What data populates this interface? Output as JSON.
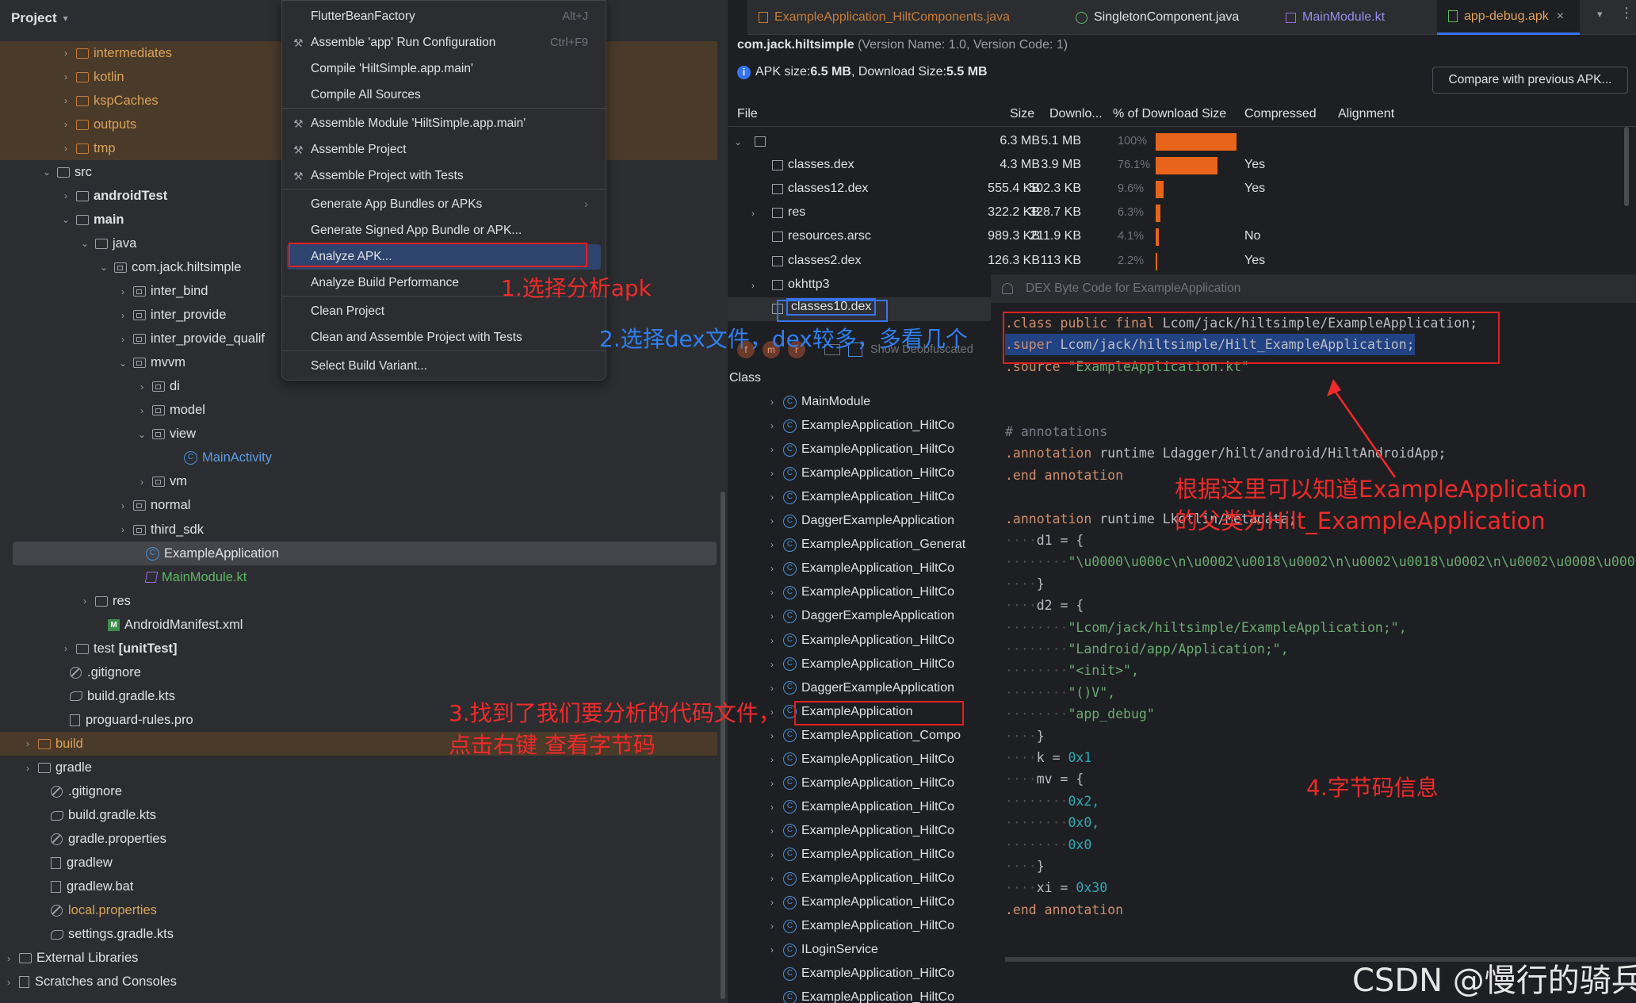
{
  "project": {
    "title": "Project",
    "header_chevron": "chevron-down",
    "rows": [
      {
        "label": "intermediates",
        "kind": "folder",
        "bold": false
      },
      {
        "label": "kotlin",
        "kind": "folder",
        "bold": false
      },
      {
        "label": "kspCaches",
        "kind": "folder",
        "bold": false
      },
      {
        "label": "outputs",
        "kind": "folder",
        "bold": false
      },
      {
        "label": "tmp",
        "kind": "folder",
        "bold": false
      },
      {
        "label": "src",
        "kind": "folder",
        "bold": false
      },
      {
        "label": "androidTest",
        "kind": "folder",
        "bold": true
      },
      {
        "label": "main",
        "kind": "folder",
        "bold": true
      },
      {
        "label": "java",
        "kind": "folder",
        "bold": false
      },
      {
        "label": "com.jack.hiltsimple",
        "kind": "package",
        "bold": false
      },
      {
        "label": "inter_bind",
        "kind": "package",
        "bold": false
      },
      {
        "label": "inter_provide",
        "kind": "package",
        "bold": false
      },
      {
        "label": "inter_provide_qualif",
        "kind": "package",
        "bold": false
      },
      {
        "label": "mvvm",
        "kind": "package",
        "bold": false
      },
      {
        "label": "di",
        "kind": "package",
        "bold": false
      },
      {
        "label": "model",
        "kind": "package",
        "bold": false
      },
      {
        "label": "view",
        "kind": "package",
        "bold": false
      },
      {
        "label": "MainActivity",
        "kind": "class",
        "bold": false
      },
      {
        "label": "vm",
        "kind": "package",
        "bold": false
      },
      {
        "label": "normal",
        "kind": "package",
        "bold": false
      },
      {
        "label": "third_sdk",
        "kind": "package",
        "bold": false
      },
      {
        "label": "ExampleApplication",
        "kind": "class",
        "bold": false
      },
      {
        "label": "MainModule.kt",
        "kind": "kotlin",
        "bold": false
      },
      {
        "label": "res",
        "kind": "folder",
        "bold": false
      },
      {
        "label": "AndroidManifest.xml",
        "kind": "manifest",
        "bold": false
      },
      {
        "label": "test",
        "suffix": "[unitTest]",
        "kind": "folder",
        "bold": false
      },
      {
        "label": ".gitignore",
        "kind": "gitignore",
        "bold": false
      },
      {
        "label": "build.gradle.kts",
        "kind": "gradle",
        "bold": false
      },
      {
        "label": "proguard-rules.pro",
        "kind": "text",
        "bold": false
      },
      {
        "label": "build",
        "kind": "folder",
        "bold": false
      },
      {
        "label": "gradle",
        "kind": "folder",
        "bold": false
      },
      {
        "label": ".gitignore",
        "kind": "gitignore",
        "bold": false
      },
      {
        "label": "build.gradle.kts",
        "kind": "gradle",
        "bold": false
      },
      {
        "label": "gradle.properties",
        "kind": "gear",
        "bold": false
      },
      {
        "label": "gradlew",
        "kind": "terminal",
        "bold": false
      },
      {
        "label": "gradlew.bat",
        "kind": "text",
        "bold": false
      },
      {
        "label": "local.properties",
        "kind": "gear",
        "bold": false
      },
      {
        "label": "settings.gradle.kts",
        "kind": "gradle",
        "bold": false
      },
      {
        "label": "External Libraries",
        "kind": "library",
        "bold": false
      },
      {
        "label": "Scratches and Consoles",
        "kind": "scratch",
        "bold": false
      }
    ]
  },
  "menu": {
    "items": [
      {
        "label": "FlutterBeanFactory",
        "shortcut": "Alt+J"
      },
      {
        "label": "Assemble 'app' Run Configuration",
        "shortcut": "Ctrl+F9"
      },
      {
        "label": "Compile 'HiltSimple.app.main'",
        "shortcut": ""
      },
      {
        "label": "Compile All Sources",
        "shortcut": ""
      },
      {
        "label": "Assemble Module 'HiltSimple.app.main'",
        "shortcut": ""
      },
      {
        "label": "Assemble Project",
        "shortcut": ""
      },
      {
        "label": "Assemble Project with Tests",
        "shortcut": ""
      },
      {
        "label": "Generate App Bundles or APKs",
        "shortcut": "›"
      },
      {
        "label": "Generate Signed App Bundle or APK...",
        "shortcut": ""
      },
      {
        "label": "Analyze APK...",
        "shortcut": ""
      },
      {
        "label": "Analyze Build Performance",
        "shortcut": ""
      },
      {
        "label": "Clean Project",
        "shortcut": ""
      },
      {
        "label": "Clean and Assemble Project with Tests",
        "shortcut": ""
      },
      {
        "label": "Select Build Variant...",
        "shortcut": ""
      }
    ]
  },
  "tabs": [
    {
      "label": "ExampleApplication_HiltComponents.java"
    },
    {
      "label": "SingletonComponent.java"
    },
    {
      "label": "MainModule.kt"
    },
    {
      "label": "app-debug.apk",
      "close": "×"
    }
  ],
  "apk": {
    "package": "com.jack.hiltsimple",
    "version": "(Version Name: 1.0, Version Code: 1)",
    "size_prefix": "APK size: ",
    "apk_size": "6.5 MB",
    "download_prefix": ", Download Size: ",
    "download_size": "5.5 MB",
    "compare_button": "Compare with previous APK...",
    "columns": [
      "File",
      "Size",
      "Downlo...",
      "% of Download Size",
      "Compressed",
      "Alignment"
    ],
    "files": [
      {
        "name": "",
        "size": "6.3 MB",
        "download": "5.1 MB",
        "pct": "100%",
        "pct_value": 100,
        "compressed": ""
      },
      {
        "name": "classes.dex",
        "size": "4.3 MB",
        "download": "3.9 MB",
        "pct": "76.1%",
        "pct_value": 76.1,
        "compressed": "Yes"
      },
      {
        "name": "classes12.dex",
        "size": "555.4 KB",
        "download": "502.3 KB",
        "pct": "9.6%",
        "pct_value": 9.6,
        "compressed": "Yes"
      },
      {
        "name": "res",
        "size": "322.2 KB",
        "download": "328.7 KB",
        "pct": "6.3%",
        "pct_value": 6.3,
        "compressed": ""
      },
      {
        "name": "resources.arsc",
        "size": "989.3 KB",
        "download": "211.9 KB",
        "pct": "4.1%",
        "pct_value": 4.1,
        "compressed": "No"
      },
      {
        "name": "classes2.dex",
        "size": "126.3 KB",
        "download": "113 KB",
        "pct": "2.2%",
        "pct_value": 2.2,
        "compressed": "Yes"
      },
      {
        "name": "okhttp3",
        "size": "",
        "download": "",
        "pct": "",
        "pct_value": 0,
        "compressed": ""
      },
      {
        "name": "classes10.dex",
        "size": "",
        "download": "",
        "pct": "",
        "pct_value": 0,
        "compressed": ""
      }
    ],
    "dex_panel_title": "DEX Byte Code for ExampleApplication",
    "show_deobf": "Show Deobfuscated",
    "class_header": "Class",
    "classes": [
      "MainModule",
      "ExampleApplication_HiltCo",
      "ExampleApplication_HiltCo",
      "ExampleApplication_HiltCo",
      "ExampleApplication_HiltCo",
      "DaggerExampleApplication",
      "ExampleApplication_Generat",
      "ExampleApplication_HiltCo",
      "ExampleApplication_HiltCo",
      "DaggerExampleApplication",
      "ExampleApplication_HiltCo",
      "ExampleApplication_HiltCo",
      "DaggerExampleApplication",
      "ExampleApplication",
      "ExampleApplication_Compo",
      "ExampleApplication_HiltCo",
      "ExampleApplication_HiltCo",
      "ExampleApplication_HiltCo",
      "ExampleApplication_HiltCo",
      "ExampleApplication_HiltCo",
      "ExampleApplication_HiltCo",
      "ExampleApplication_HiltCo",
      "ExampleApplication_HiltCo",
      "ILoginService",
      "ExampleApplication_HiltCo",
      "ExampleApplication_HiltCo"
    ]
  },
  "bytecode": [
    [
      [
        ".class public final ",
        "k"
      ],
      [
        "Lcom/jack/hiltsimple/ExampleApplication;",
        "w"
      ]
    ],
    [
      [
        ".super ",
        "k"
      ],
      [
        "Lcom/jack/hiltsimple/Hilt_ExampleApplication",
        "w"
      ],
      [
        ";",
        "w"
      ]
    ],
    [
      [
        ".source ",
        "k"
      ],
      [
        "\"ExampleApplication.kt\"",
        "s"
      ]
    ],
    [],
    [],
    [
      [
        "# annotations",
        "c"
      ]
    ],
    [
      [
        ".annotation ",
        "k"
      ],
      [
        "runtime Ldagger/hilt/android/HiltAndroidApp;",
        "w"
      ]
    ],
    [
      [
        ".end annotation",
        "k"
      ]
    ],
    [],
    [
      [
        ".annotation ",
        "k"
      ],
      [
        "runtime Lkotlin/Metadata;",
        "w"
      ]
    ],
    [
      [
        "····",
        "d"
      ],
      [
        "d1 = {",
        "w"
      ]
    ],
    [
      [
        "········",
        "d"
      ],
      [
        "\"\\u0000\\u000c\\n\\u0002\\u0018\\u0002\\n\\u0002\\u0018\\u0002\\n\\u0002\\u0008\\u000",
        "s"
      ]
    ],
    [
      [
        "····",
        "d"
      ],
      [
        "}",
        "w"
      ]
    ],
    [
      [
        "····",
        "d"
      ],
      [
        "d2 = {",
        "w"
      ]
    ],
    [
      [
        "········",
        "d"
      ],
      [
        "\"Lcom/jack/hiltsimple/ExampleApplication;\",",
        "s"
      ]
    ],
    [
      [
        "········",
        "d"
      ],
      [
        "\"Landroid/app/Application;\",",
        "s"
      ]
    ],
    [
      [
        "········",
        "d"
      ],
      [
        "\"<init>\",",
        "s"
      ]
    ],
    [
      [
        "········",
        "d"
      ],
      [
        "\"()V\",",
        "s"
      ]
    ],
    [
      [
        "········",
        "d"
      ],
      [
        "\"app_debug\"",
        "s"
      ]
    ],
    [
      [
        "····",
        "d"
      ],
      [
        "}",
        "w"
      ]
    ],
    [
      [
        "····",
        "d"
      ],
      [
        "k = ",
        "w"
      ],
      [
        "0x1",
        "n"
      ]
    ],
    [
      [
        "····",
        "d"
      ],
      [
        "mv = {",
        "w"
      ]
    ],
    [
      [
        "········",
        "d"
      ],
      [
        "0x2,",
        "n"
      ]
    ],
    [
      [
        "········",
        "d"
      ],
      [
        "0x0,",
        "n"
      ]
    ],
    [
      [
        "········",
        "d"
      ],
      [
        "0x0",
        "n"
      ]
    ],
    [
      [
        "····",
        "d"
      ],
      [
        "}",
        "w"
      ]
    ],
    [
      [
        "····",
        "d"
      ],
      [
        "xi = ",
        "w"
      ],
      [
        "0x30",
        "n"
      ]
    ],
    [
      [
        ".end annotation",
        "k"
      ]
    ]
  ],
  "annotations": {
    "step1": "1.选择分析apk",
    "step2": "2.选择dex文件，dex较多，多看几个",
    "step3_line1": "3.找到了我们要分析的代码文件，",
    "step3_line2": "点击右键 查看字节码",
    "step4": "4.字节码信息",
    "note_line1": "根据这里可以知道ExampleApplication",
    "note_line2": "的父类为Hilt_ExampleApplication"
  },
  "watermark": "CSDN @慢行的骑兵",
  "colors": {
    "accent": "#3574f0",
    "bar": "#e8641b",
    "annotation_red": "#f02a2a",
    "annotation_blue": "#2f7ff0"
  }
}
